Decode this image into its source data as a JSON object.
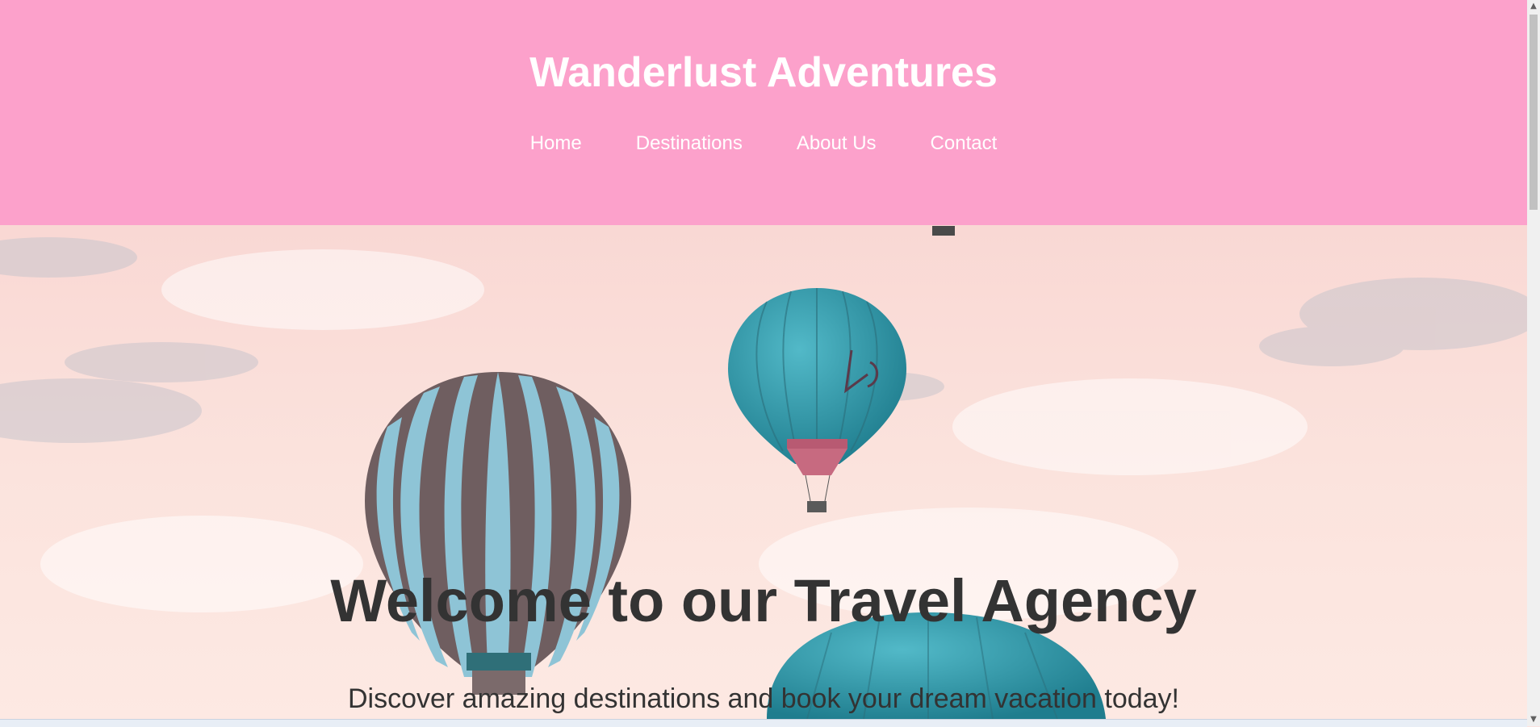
{
  "header": {
    "title": "Wanderlust Adventures",
    "nav": [
      {
        "label": "Home"
      },
      {
        "label": "Destinations"
      },
      {
        "label": "About Us"
      },
      {
        "label": "Contact"
      }
    ],
    "background_color": "#fca1cb"
  },
  "hero": {
    "heading": "Welcome to our Travel Agency",
    "subtitle": "Discover amazing destinations and book your dream vacation today!",
    "image_alt": "hot air balloons in pink sky"
  },
  "colors": {
    "header_bg": "#fca1cb",
    "sky": "#fbe3e0",
    "balloon_teal": "#3aa3b4",
    "text_dark": "#333333"
  },
  "icons": {
    "scroll_up": "▲",
    "scroll_down": "▼"
  }
}
